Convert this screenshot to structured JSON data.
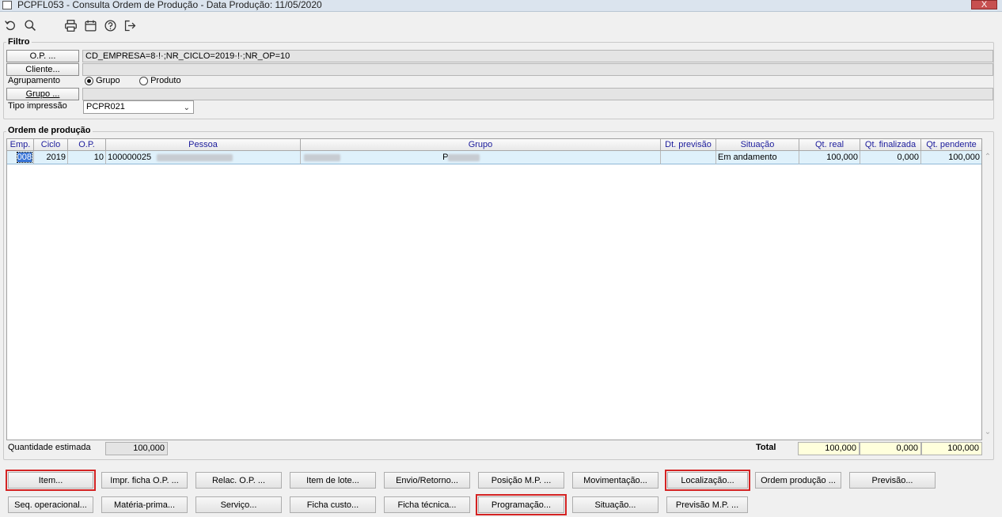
{
  "window": {
    "title": "PCPFL053 - Consulta Ordem de Produção - Data Produção: 11/05/2020",
    "close": "X"
  },
  "toolbar": {
    "icons": [
      "undo-icon",
      "search-icon",
      "print-icon",
      "calendar-icon",
      "help-icon",
      "exit-icon"
    ]
  },
  "filtro": {
    "title": "Filtro",
    "op_button": "O.P. ...",
    "op_value": "CD_EMPRESA=8·!·;NR_CICLO=2019·!·;NR_OP=10",
    "cliente_button": "Cliente...",
    "cliente_value": "",
    "agrupamento_label": "Agrupamento",
    "radio_grupo": "Grupo",
    "radio_produto": "Produto",
    "agrupamento_selected": "Grupo",
    "grupo_button": "Grupo ...",
    "grupo_value": "",
    "tipo_impressao_label": "Tipo impressão",
    "tipo_impressao_value": "PCPR021"
  },
  "ordem": {
    "title": "Ordem de produção",
    "columns": [
      "Emp.",
      "Ciclo",
      "O.P.",
      "Pessoa",
      "Grupo",
      "Dt. previsão",
      "Situação",
      "Qt. real",
      "Qt. finalizada",
      "Qt. pendente"
    ],
    "rows": [
      {
        "emp": "008",
        "ciclo": "2019",
        "op": "10",
        "pessoa": "100000025",
        "grupo_prefix": "P",
        "dt_previsao": "",
        "situacao": "Em andamento",
        "qt_real": "100,000",
        "qt_finalizada": "0,000",
        "qt_pendente": "100,000"
      }
    ]
  },
  "summary": {
    "quantidade_estimada_label": "Quantidade estimada",
    "quantidade_estimada": "100,000",
    "total_label": "Total",
    "total_real": "100,000",
    "total_finalizada": "0,000",
    "total_pendente": "100,000"
  },
  "buttons_row1": [
    "Item...",
    "Impr. ficha O.P. ...",
    "Relac. O.P. ...",
    "Item de lote...",
    "Envio/Retorno...",
    "Posição M.P. ...",
    "Movimentação...",
    "Localização...",
    "Ordem produção ...",
    "Previsão..."
  ],
  "buttons_row2": [
    "Seq. operacional...",
    "Matéria-prima...",
    "Serviço...",
    "Ficha custo...",
    "Ficha técnica...",
    "Programação...",
    "Situação...",
    "Previsão M.P. ..."
  ],
  "highlighted_buttons": [
    "Item...",
    "Localização...",
    "Programação..."
  ],
  "colors": {
    "highlight_border": "#d42323",
    "selected_row": "#dff1fb",
    "header_text": "#1c1c9c",
    "totals_bg": "#ffffdc"
  }
}
